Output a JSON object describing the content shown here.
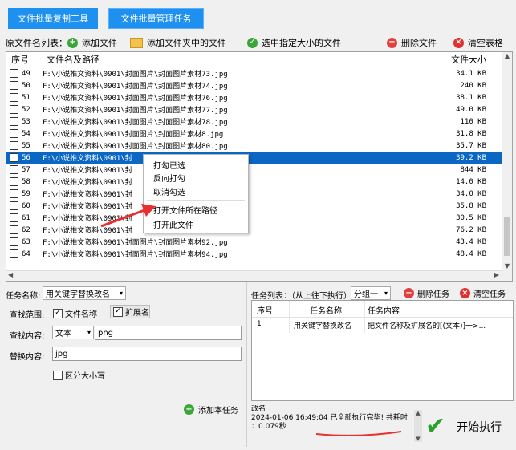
{
  "tabs": [
    "文件批量复制工具",
    "文件批量管理任务"
  ],
  "toolbar": {
    "list_label": "原文件名列表：",
    "add_file": "添加文件",
    "add_folder_files": "添加文件夹中的文件",
    "select_size": "选中指定大小的文件",
    "delete_file": "删除文件",
    "clear_table": "清空表格"
  },
  "grid": {
    "headers": [
      "序号",
      "文件名及路径",
      "文件大小"
    ],
    "rows": [
      {
        "no": "49",
        "path": "F:\\小说推文资料\\0901\\封面图片\\封面图片素材73.jpg",
        "size": "34.1 KB"
      },
      {
        "no": "50",
        "path": "F:\\小说推文资料\\0901\\封面图片\\封面图片素材74.jpg",
        "size": "240 KB"
      },
      {
        "no": "51",
        "path": "F:\\小说推文资料\\0901\\封面图片\\封面图片素材76.jpg",
        "size": "38.1 KB"
      },
      {
        "no": "52",
        "path": "F:\\小说推文资料\\0901\\封面图片\\封面图片素材77.jpg",
        "size": "49.0 KB"
      },
      {
        "no": "53",
        "path": "F:\\小说推文资料\\0901\\封面图片\\封面图片素材78.jpg",
        "size": "110 KB"
      },
      {
        "no": "54",
        "path": "F:\\小说推文资料\\0901\\封面图片\\封面图片素材8.jpg",
        "size": "31.8 KB"
      },
      {
        "no": "55",
        "path": "F:\\小说推文资料\\0901\\封面图片\\封面图片素材80.jpg",
        "size": "35.7 KB"
      },
      {
        "no": "56",
        "path": "F:\\小说推文资料\\0901\\封",
        "size": "39.2 KB"
      },
      {
        "no": "57",
        "path": "F:\\小说推文资料\\0901\\封",
        "size": "844 KB"
      },
      {
        "no": "58",
        "path": "F:\\小说推文资料\\0901\\封",
        "size": "14.0 KB"
      },
      {
        "no": "59",
        "path": "F:\\小说推文资料\\0901\\封",
        "size": "34.0 KB"
      },
      {
        "no": "60",
        "path": "F:\\小说推文资料\\0901\\封",
        "size": "35.8 KB"
      },
      {
        "no": "61",
        "path": "F:\\小说推文资料\\0901\\封",
        "size": "30.5 KB"
      },
      {
        "no": "62",
        "path": "F:\\小说推文资料\\0901\\封",
        "size": "76.2 KB"
      },
      {
        "no": "63",
        "path": "F:\\小说推文资料\\0901\\封面图片\\封面图片素材92.jpg",
        "size": "43.4 KB"
      },
      {
        "no": "64",
        "path": "F:\\小说推文资料\\0901\\封面图片\\封面图片素材94.jpg",
        "size": "48.4 KB"
      }
    ]
  },
  "context_menu": [
    "打勾已选",
    "反向打勾",
    "取消勾选",
    "打开文件所在路径",
    "打开此文件"
  ],
  "task": {
    "name_label": "任务名称:",
    "name_value": "用关键字替换改名",
    "scope_label": "查找范围:",
    "scope_filename": "文件名称",
    "scope_ext": "扩展名",
    "find_label": "查找内容:",
    "find_type": "文本",
    "find_value": "png",
    "replace_label": "替换内容:",
    "replace_value": "jpg",
    "case_label": "区分大小写",
    "add_task": "添加本任务"
  },
  "task_list": {
    "label": "任务列表：（从上往下执行）",
    "group": "分组一",
    "delete_task": "删除任务",
    "clear_task": "清空任务",
    "headers": [
      "序号",
      "任务名称",
      "任务内容"
    ],
    "rows": [
      {
        "no": "1",
        "name": "用关键字替换改名",
        "content": "把文件名称及扩展名的[(文本)]一>..."
      }
    ]
  },
  "log": {
    "line1": "改名",
    "line2": "2024-01-06 16:49:04 已全部执行完毕! 共耗时",
    "line3": "：0.079秒"
  },
  "start_button": "开始执行",
  "colors": {
    "tab": "#1e90f0",
    "selected_row": "#0b67c4",
    "annotation": "#e8302f"
  }
}
